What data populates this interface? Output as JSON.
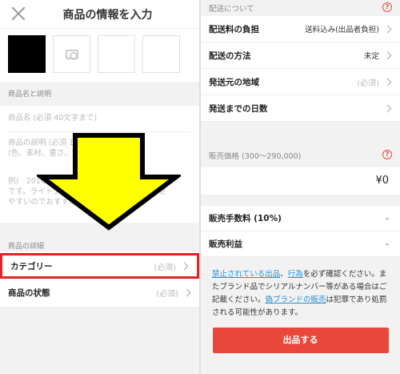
{
  "left": {
    "title": "商品の情報を入力",
    "name_section_label": "商品名と説明",
    "name_placeholder": "商品名 (必須 40文字まで)",
    "desc_placeholder_line1": "商品の説明 (必須 1,000文字以内)",
    "desc_placeholder_line2": "(色、素材、重さ、定価、注意点など)",
    "example_line1": "例)　2010年頃に1万円で購入したジャケット",
    "example_line2": "です。ライトグレーで傷はありません。あわせ",
    "example_line3": "やすいのでおすすめです。",
    "details_section_label": "商品の詳細",
    "category_label": "カテゴリー",
    "category_required": "(必須)",
    "condition_label": "商品の状態",
    "condition_required": "(必須)"
  },
  "right": {
    "shipping_section_label": "配送について",
    "help_glyph": "?",
    "shipping_fee_label": "配送料の負担",
    "shipping_fee_value": "送料込み(出品者負担)",
    "shipping_method_label": "配送の方法",
    "shipping_method_value": "未定",
    "ship_from_label": "発送元の地域",
    "ship_from_required": "(必須)",
    "ship_days_label": "発送までの日数",
    "price_section_label": "販売価格 (300〜290,000)",
    "price_value": "¥0",
    "fee_label": "販売手数料 (10%)",
    "fee_value": "-",
    "profit_label": "販売利益",
    "profit_value": "-",
    "notice_link1": "禁止されている出品",
    "notice_sep1": "、",
    "notice_link2": "行為",
    "notice_text1": "を必ず確認ください。またブランド品でシリアルナンバー等がある場合はご記載ください。",
    "notice_link3": "偽ブランドの販売",
    "notice_text2": "は犯罪であり処罰される可能性があります。",
    "submit_label": "出品する"
  },
  "colors": {
    "highlight_border": "#e52226",
    "arrow_fill": "#ffff00",
    "submit_bg": "#e8473a",
    "link": "#2a8fd6"
  }
}
